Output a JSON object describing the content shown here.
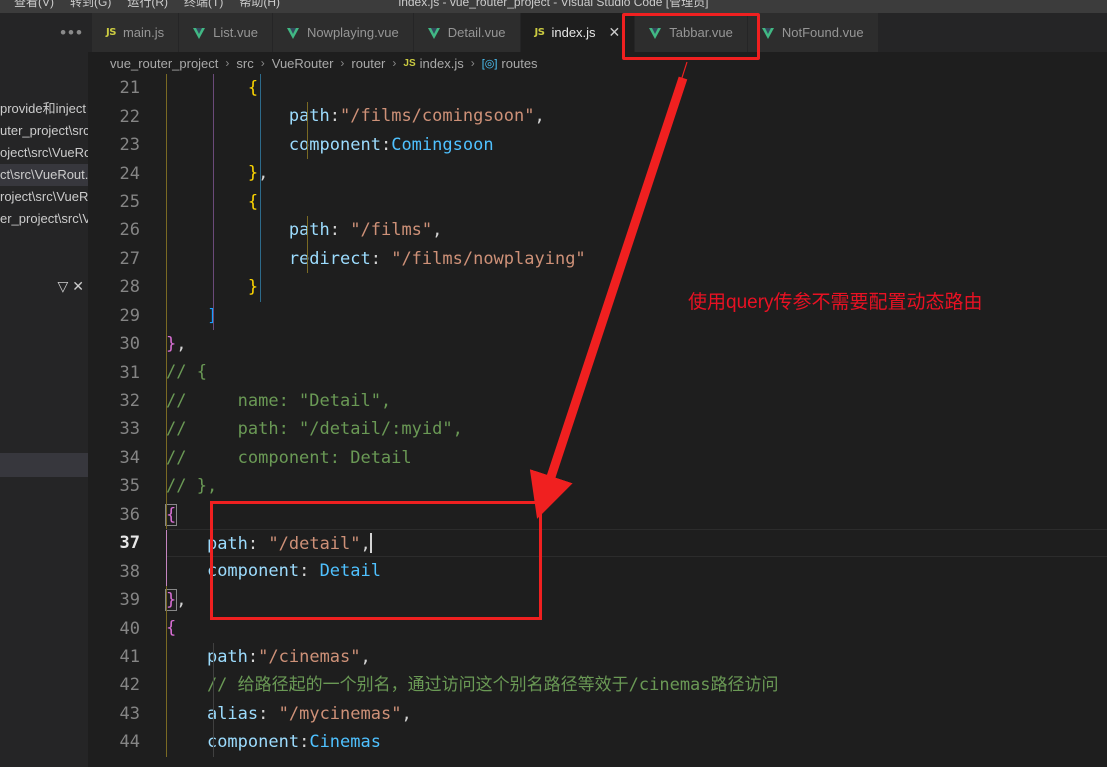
{
  "titlebar": {
    "window_title": "index.js - vue_router_project - Visual Studio Code [管理员]",
    "menus": [
      "查看(V)",
      "转到(G)",
      "运行(R)",
      "终端(T)",
      "帮助(H)"
    ]
  },
  "sidebar": {
    "results_header": "provide和inject",
    "results": [
      {
        "label": "provide和inject",
        "selected": false
      },
      {
        "label": "uter_project\\src...",
        "selected": false
      },
      {
        "label": "oject\\src\\VueRo...",
        "selected": false
      },
      {
        "label": "ct\\src\\VueRout...",
        "selected": true
      },
      {
        "label": "roject\\src\\VueR...",
        "selected": false
      },
      {
        "label": "er_project\\src\\V...",
        "selected": false
      }
    ],
    "toolbar": {
      "filter_icon": "filter-icon",
      "close_icon": "close-icon",
      "filter_glyph": "▽",
      "close_glyph": "✕"
    }
  },
  "tabbar": {
    "overflow_glyph": "•••",
    "tabs": [
      {
        "label": "main.js",
        "icon": "js-icon",
        "active": false,
        "closable": false
      },
      {
        "label": "List.vue",
        "icon": "vue-icon",
        "active": false,
        "closable": false
      },
      {
        "label": "Nowplaying.vue",
        "icon": "vue-icon",
        "active": false,
        "closable": false
      },
      {
        "label": "Detail.vue",
        "icon": "vue-icon",
        "active": false,
        "closable": false
      },
      {
        "label": "index.js",
        "icon": "js-icon",
        "active": true,
        "closable": true,
        "close_glyph": "✕"
      },
      {
        "label": "Tabbar.vue",
        "icon": "vue-icon",
        "active": false,
        "closable": false
      },
      {
        "label": "NotFound.vue",
        "icon": "vue-icon",
        "active": false,
        "closable": false
      }
    ]
  },
  "breadcrumb": {
    "separator": "›",
    "segments": [
      {
        "label": "vue_router_project",
        "icon": ""
      },
      {
        "label": "src",
        "icon": ""
      },
      {
        "label": "VueRouter",
        "icon": ""
      },
      {
        "label": "router",
        "icon": ""
      },
      {
        "label": "index.js",
        "icon": "js-icon"
      },
      {
        "label": "routes",
        "icon": "symbol-icon"
      }
    ]
  },
  "editor": {
    "first_line": 21,
    "current_line": 37,
    "lines": [
      {
        "no": 21,
        "text": "        {"
      },
      {
        "no": 22,
        "text": "            path:\"/films/comingsoon\","
      },
      {
        "no": 23,
        "text": "            component:Comingsoon"
      },
      {
        "no": 24,
        "text": "        },"
      },
      {
        "no": 25,
        "text": "        {"
      },
      {
        "no": 26,
        "text": "            path: \"/films\","
      },
      {
        "no": 27,
        "text": "            redirect: \"/films/nowplaying\""
      },
      {
        "no": 28,
        "text": "        }"
      },
      {
        "no": 29,
        "text": "    ]"
      },
      {
        "no": 30,
        "text": "},"
      },
      {
        "no": 31,
        "text": "// {"
      },
      {
        "no": 32,
        "text": "//     name: \"Detail\","
      },
      {
        "no": 33,
        "text": "//     path: \"/detail/:myid\","
      },
      {
        "no": 34,
        "text": "//     component: Detail"
      },
      {
        "no": 35,
        "text": "// },"
      },
      {
        "no": 36,
        "text": "{"
      },
      {
        "no": 37,
        "text": "    path: \"/detail\","
      },
      {
        "no": 38,
        "text": "    component: Detail"
      },
      {
        "no": 39,
        "text": "},"
      },
      {
        "no": 40,
        "text": "{"
      },
      {
        "no": 41,
        "text": "    path:\"/cinemas\","
      },
      {
        "no": 42,
        "text": "    // 给路径起的一个别名，通过访问这个别名路径等效于/cinemas路径访问"
      },
      {
        "no": 43,
        "text": "    alias: \"/mycinemas\","
      },
      {
        "no": 44,
        "text": "    component:Cinemas"
      }
    ]
  },
  "annotations": {
    "note_text": "使用query传参不需要配置动态路由",
    "note_color": "#e81123",
    "highlight_color": "#f02020",
    "arrow_from": "index.js tab",
    "arrow_to": "route object block lines 36-39"
  },
  "colors": {
    "editor_background": "#1e1e1e",
    "sidebar_background": "#252526",
    "tab_inactive": "#2d2d2d",
    "tab_active": "#1e1e1e",
    "titlebar": "#3c3c3c",
    "string": "#ce9178",
    "property": "#9cdcfe",
    "comment": "#6a9955",
    "component": "#4fc1ff",
    "bracket_yellow": "#ffd700",
    "bracket_pink": "#da70d6",
    "bracket_blue": "#179fff"
  }
}
